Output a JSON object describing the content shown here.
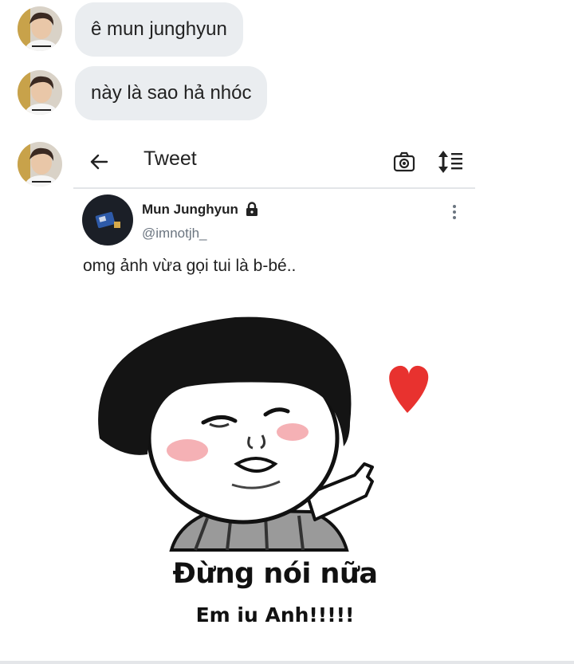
{
  "messages": [
    {
      "text": "ê mun junghyun"
    },
    {
      "text": "này là sao hả nhóc"
    }
  ],
  "tweet_screen": {
    "header_title": "Tweet",
    "icons": [
      "back-arrow-icon",
      "camera-icon",
      "sort-icon",
      "lock-icon",
      "more-vertical-icon"
    ],
    "author": {
      "display_name": "Mun Junghyun",
      "handle": "@imnotjh_",
      "protected": true
    },
    "text": "omg ảnh vừa gọi tui là b-bé..",
    "meme": {
      "line1": "Đừng nói nữa",
      "line2": "Em iu Anh!!!!!"
    }
  },
  "colors": {
    "bubble": "#eaedf0",
    "heart": "#e8322f",
    "text": "#222222",
    "handle": "#6b7580"
  }
}
